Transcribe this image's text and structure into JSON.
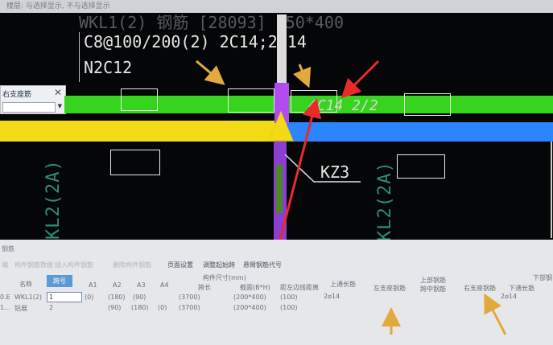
{
  "topbar": {
    "hint": "楼层:   与选择显示,  不与选择显示"
  },
  "cad": {
    "line_ghost": "WKL1(2) 钢筋 [28093] 250*400",
    "stirrup_text": "C8@100/200(2) 2C14;2C14",
    "n_text": "N2C12",
    "bottom_text": "4C14 2/2",
    "column_label": "KZ3",
    "left_vertical": "KL2(2A)",
    "right_vertical": "KL2(2A)",
    "colors": {
      "green_beam": "#36d41d",
      "yellow_beam": "#f2db16",
      "blue_beam": "#2c84ff",
      "purple_column": "#b34cf0",
      "red_arrow": "#ea2a2a",
      "orange_arrow": "#e3a93c"
    }
  },
  "dialog": {
    "title": "右支座筋",
    "close": "✕"
  },
  "panel": {
    "header": "钢筋",
    "toolbar": [
      {
        "label": "编",
        "on": false
      },
      {
        "label": "构件钢筋数据",
        "on": false
      },
      {
        "label": "插入构件钢筋",
        "on": false
      },
      {
        "label": "删除构件钢筋",
        "on": false
      },
      {
        "label": "页面设置",
        "on": true
      },
      {
        "label": "调整起始跨",
        "on": true
      },
      {
        "label": "悬臂钢筋代号",
        "on": true
      }
    ],
    "col_headers": {
      "name": "名称",
      "span": "跨号",
      "a1": "A1",
      "a2": "A2",
      "a3": "A3",
      "a4": "A4",
      "dim_group": "构件尺寸(mm)",
      "span_len": "跨长",
      "section": "截面(B*H)",
      "dist": "距左边线距离",
      "top_through": "上通长筋",
      "left_support": "左支座钢筋",
      "top_rebar_group": "上部钢筋",
      "mid_span": "跨中钢筋",
      "right_support": "右支座钢筋",
      "bottom_through": "下通长筋",
      "bottom_group": "下部钢"
    },
    "rows": [
      {
        "prefix": "0.E",
        "name": "WKL1(2)",
        "span": "1",
        "a1": "(0)",
        "a2": "(180)",
        "a3": "(90)",
        "span_len": "(3700)",
        "section": "(200*400)",
        "dist": "(100)",
        "top_through": "2⌀14",
        "bottom_through": "2⌀14"
      },
      {
        "prefix": "1...",
        "name": "铝展",
        "span": "2",
        "a1": "",
        "a2": "(90)",
        "a3": "(180)",
        "a4": "(0)",
        "span_len": "(3700)",
        "section": "(200*400)",
        "dist": "(100)"
      }
    ]
  }
}
